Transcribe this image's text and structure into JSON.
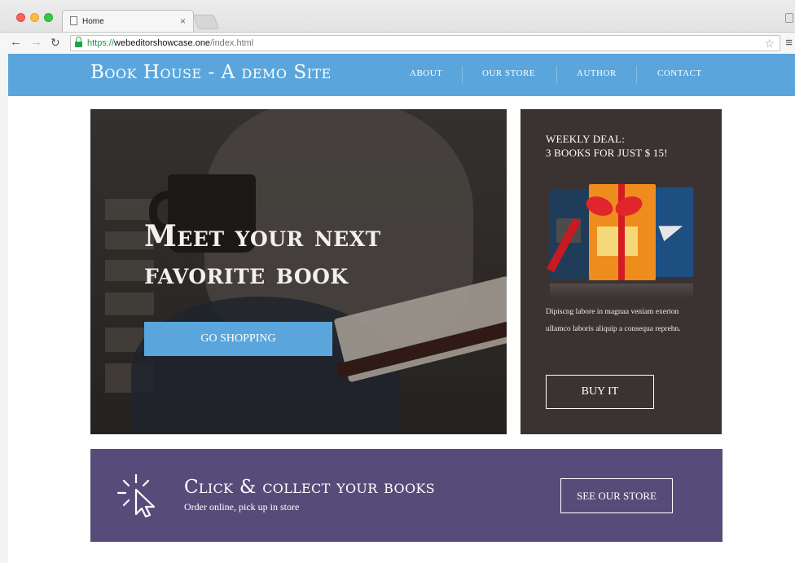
{
  "browser": {
    "tab_title": "Home",
    "tab_close": "×",
    "url_scheme": "https://",
    "url_host": "webeditorshowcase.one",
    "url_path": "/index.html"
  },
  "header": {
    "brand": "Book House - A demo Site",
    "nav": [
      "ABOUT",
      "OUR STORE",
      "AUTHOR",
      "CONTACT"
    ],
    "color": "#5aa6dc"
  },
  "hero": {
    "title_line1": "Meet your next",
    "title_line2": "favorite book",
    "button": "GO SHOPPING"
  },
  "deal": {
    "title_line1": "WEEKLY DEAL:",
    "title_line2": "3 BOOKS FOR JUST $ 15!",
    "description": "Dipiscng labore in magnaa veniam exerton ullamco laboris aliquip a consequa reprehn.",
    "button": "BUY IT",
    "color": "#3b3331"
  },
  "collect": {
    "title": "Click & collect your books",
    "subtitle": "Order online, pick up in store",
    "button": "SEE OUR STORE",
    "color": "#574c79"
  },
  "icons": {
    "cursor": "cursor-click-icon",
    "lock": "lock-icon",
    "star": "star-icon",
    "menu": "menu-icon"
  }
}
